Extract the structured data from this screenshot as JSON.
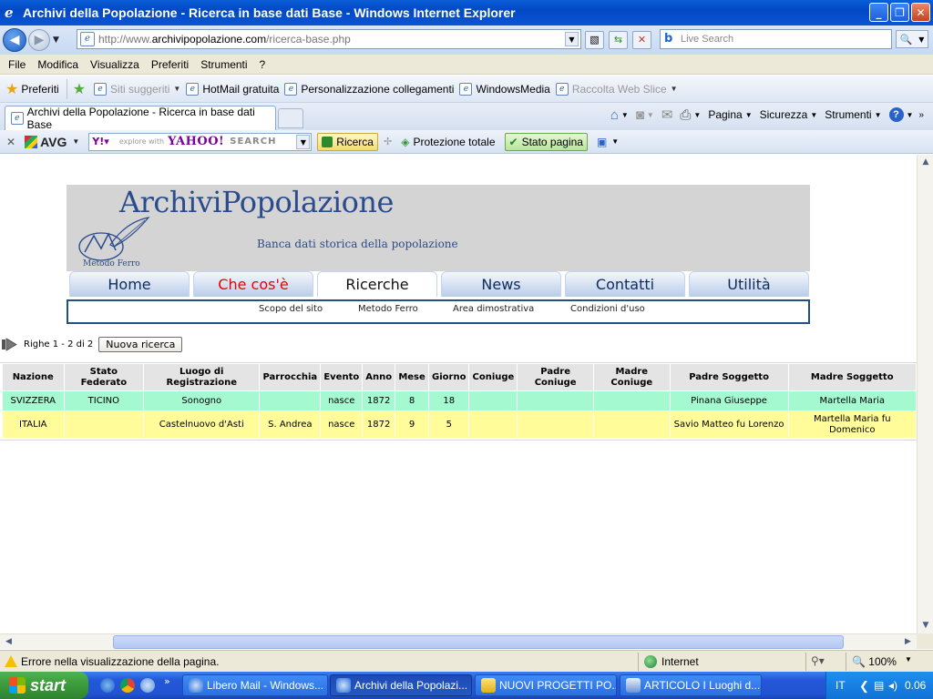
{
  "window": {
    "title": "Archivi della Popolazione - Ricerca in base dati Base - Windows Internet Explorer",
    "minimize": "_",
    "restore": "❐",
    "close": "✕"
  },
  "address": {
    "url_prefix": "http://www.",
    "url_host": "archivipopolazione.com",
    "url_path": "/ricerca-base.php",
    "search_placeholder": "Live Search"
  },
  "menu": [
    "File",
    "Modifica",
    "Visualizza",
    "Preferiti",
    "Strumenti",
    "?"
  ],
  "favorites": {
    "label": "Preferiti",
    "items": [
      {
        "label": "Siti suggeriti",
        "disabled": true
      },
      {
        "label": "HotMail gratuita",
        "disabled": false
      },
      {
        "label": "Personalizzazione collegamenti",
        "disabled": false
      },
      {
        "label": "WindowsMedia",
        "disabled": false
      },
      {
        "label": "Raccolta Web Slice",
        "disabled": true
      }
    ]
  },
  "tabs": {
    "active_label": "Archivi della Popolazione - Ricerca in base dati Base"
  },
  "commandbar": {
    "pagina": "Pagina",
    "sicurezza": "Sicurezza",
    "strumenti": "Strumenti",
    "help": "?"
  },
  "avg": {
    "logo": "AVG",
    "explore_with": "explore with",
    "yahoo": "YAHOO!",
    "search": "SEARCH",
    "ricerca": "Ricerca",
    "protezione": "Protezione totale",
    "stato": "Stato pagina"
  },
  "site": {
    "name": "ArchiviPopolazione",
    "tagline": "Banca dati storica della popolazione",
    "logo_label": "Metodo Ferro",
    "nav": [
      {
        "label": "Home",
        "state": "normal"
      },
      {
        "label": "Che cos'è",
        "state": "red"
      },
      {
        "label": "Ricerche",
        "state": "active"
      },
      {
        "label": "News",
        "state": "normal"
      },
      {
        "label": "Contatti",
        "state": "normal"
      },
      {
        "label": "Utilità",
        "state": "normal"
      }
    ],
    "subnav": [
      "Scopo del sito",
      "Metodo Ferro",
      "Area dimostrativa",
      "Condizioni d'uso"
    ]
  },
  "results": {
    "rows_info": "Righe 1 - 2 di 2",
    "new_search": "Nuova ricerca",
    "columns": [
      "Nazione",
      "Stato Federato",
      "Luogo di Registrazione",
      "Parrocchia",
      "Evento",
      "Anno",
      "Mese",
      "Giorno",
      "Coniuge",
      "Padre Coniuge",
      "Madre Coniuge",
      "Padre Soggetto",
      "Madre Soggetto"
    ],
    "rows": [
      [
        "SVIZZERA",
        "TICINO",
        "Sonogno",
        "",
        "nasce",
        "1872",
        "8",
        "18",
        "",
        "",
        "",
        "Pinana Giuseppe",
        "Martella Maria"
      ],
      [
        "ITALIA",
        "",
        "Castelnuovo d'Asti",
        "S. Andrea",
        "nasce",
        "1872",
        "9",
        "5",
        "",
        "",
        "",
        "Savio Matteo fu Lorenzo",
        "Martella Maria fu Domenico"
      ]
    ]
  },
  "status": {
    "message": "Errore nella visualizzazione della pagina.",
    "zone": "Internet",
    "zoom": "100%"
  },
  "taskbar": {
    "start": "start",
    "items": [
      {
        "label": "Libero Mail - Windows...",
        "active": false
      },
      {
        "label": "Archivi della Popolazi...",
        "active": true
      },
      {
        "label": "NUOVI PROGETTI PO...",
        "active": false
      },
      {
        "label": "ARTICOLO I Luoghi d...",
        "active": false
      }
    ],
    "lang": "IT",
    "clock": "0.06"
  },
  "colors": {
    "row_green": "#a4f9d1",
    "row_yellow": "#fffc99",
    "site_blue": "#2a4b8c",
    "nav_red": "#e00000"
  }
}
